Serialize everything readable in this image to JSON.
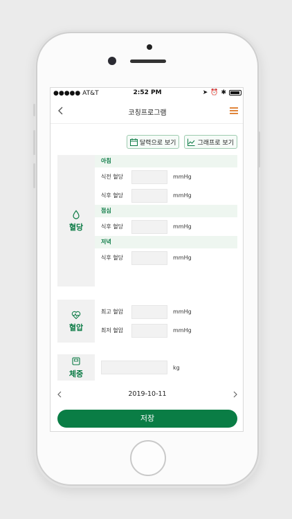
{
  "status": {
    "carrier": "●●●●● AT&T",
    "time": "2:52 PM"
  },
  "nav": {
    "title": "코칭프로그램"
  },
  "buttons": {
    "calendar": "달력으로 보기",
    "graph": "그래프로 보기"
  },
  "glucose": {
    "label": "혈당",
    "morning": {
      "title": "아침",
      "before_label": "식전 혈당",
      "after_label": "식후 혈당"
    },
    "lunch": {
      "title": "점심",
      "after_label": "식후 혈당"
    },
    "dinner": {
      "title": "저녁",
      "after_label": "식후 혈당"
    },
    "unit": "mmHg"
  },
  "pressure": {
    "label": "혈압",
    "high_label": "최고 혈압",
    "low_label": "최저 혈압",
    "unit": "mmHg"
  },
  "weight": {
    "label": "체중",
    "unit": "kg"
  },
  "date": "2019-10-11",
  "save": "저장",
  "colors": {
    "accent": "#0a7d45",
    "menu": "#e0853a",
    "section_bg": "#f1f1f1"
  }
}
